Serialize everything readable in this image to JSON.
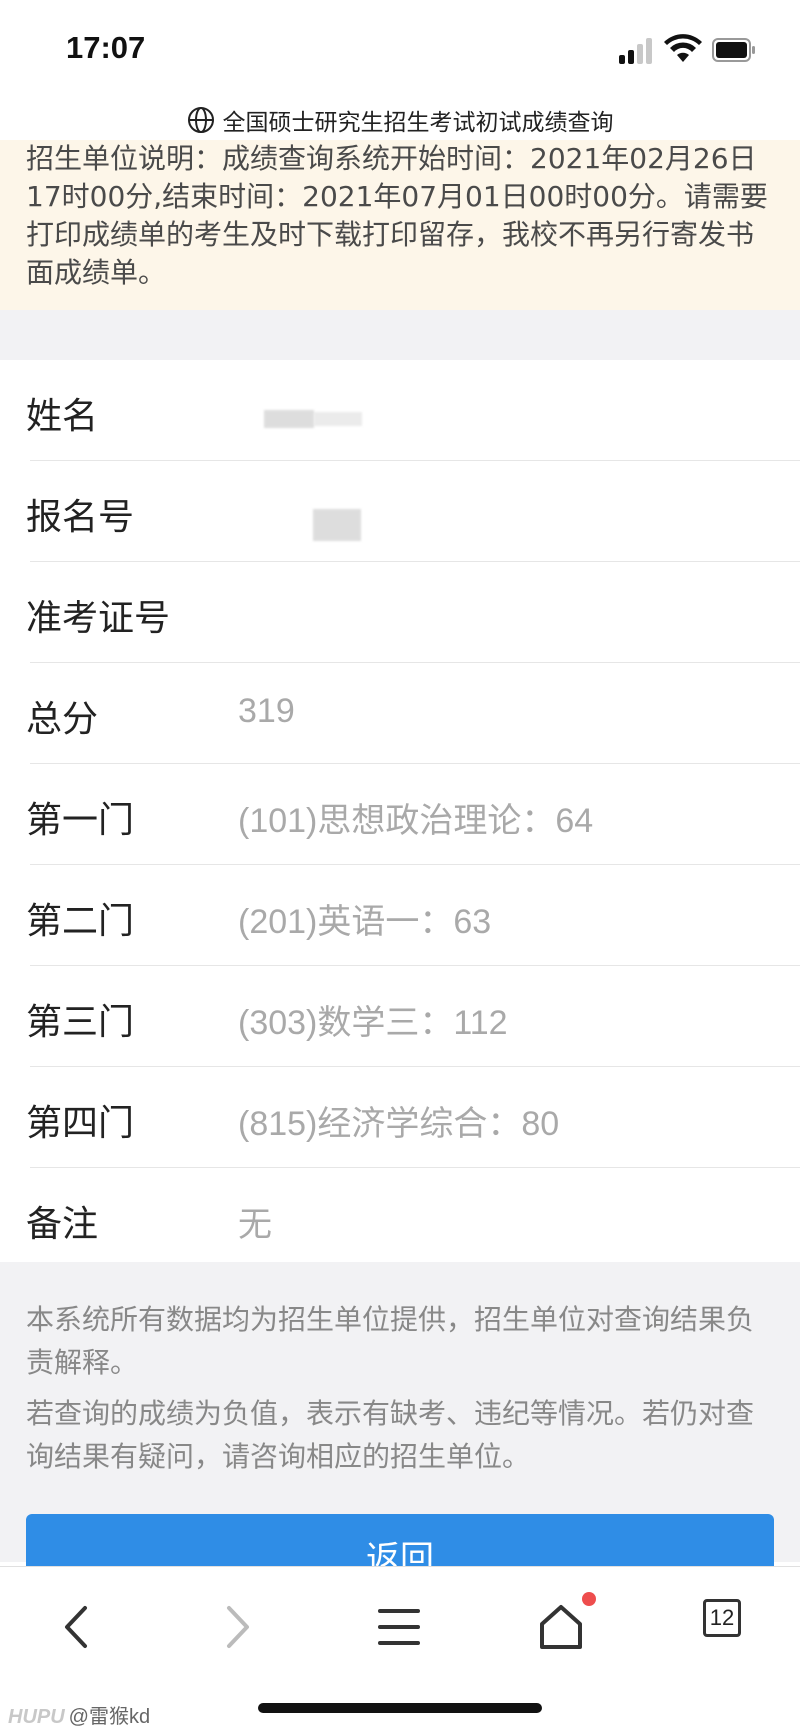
{
  "status_bar": {
    "time": "17:07"
  },
  "header": {
    "title": "全国硕士研究生招生考试初试成绩查询"
  },
  "notice": {
    "text": "招生单位说明：成绩查询系统开始时间：2021年02月26日17时00分,结束时间：2021年07月01日00时00分。请需要打印成绩单的考生及时下载打印留存，我校不再另行寄发书面成绩单。"
  },
  "rows": [
    {
      "label": "姓名",
      "value": ""
    },
    {
      "label": "报名号",
      "value": ""
    },
    {
      "label": "准考证号",
      "value": ""
    },
    {
      "label": "总分",
      "value": "319"
    },
    {
      "label": "第一门",
      "value": "(101)思想政治理论：64"
    },
    {
      "label": "第二门",
      "value": "(201)英语一：63"
    },
    {
      "label": "第三门",
      "value": "(303)数学三：112"
    },
    {
      "label": "第四门",
      "value": "(815)经济学综合：80"
    },
    {
      "label": "备注",
      "value": "无"
    }
  ],
  "footer": {
    "para1": "本系统所有数据均为招生单位提供，招生单位对查询结果负责解释。",
    "para2": "若查询的成绩为负值，表示有缺考、违纪等情况。若仍对查询结果有疑问，请咨询相应的招生单位。"
  },
  "return_button": {
    "label": "返回"
  },
  "browser_bar": {
    "tab_count": "12",
    "icons": [
      "back-icon",
      "forward-icon",
      "menu-icon",
      "home-icon",
      "tabs-icon"
    ],
    "notification_color": "#ee4d4d"
  },
  "watermark": {
    "brand": "HUPU",
    "user": "@雷猴kd"
  },
  "colors": {
    "notice_bg": "#fdf6e9",
    "button_bg": "#2f8de6",
    "value_text": "#a9a9a9"
  }
}
